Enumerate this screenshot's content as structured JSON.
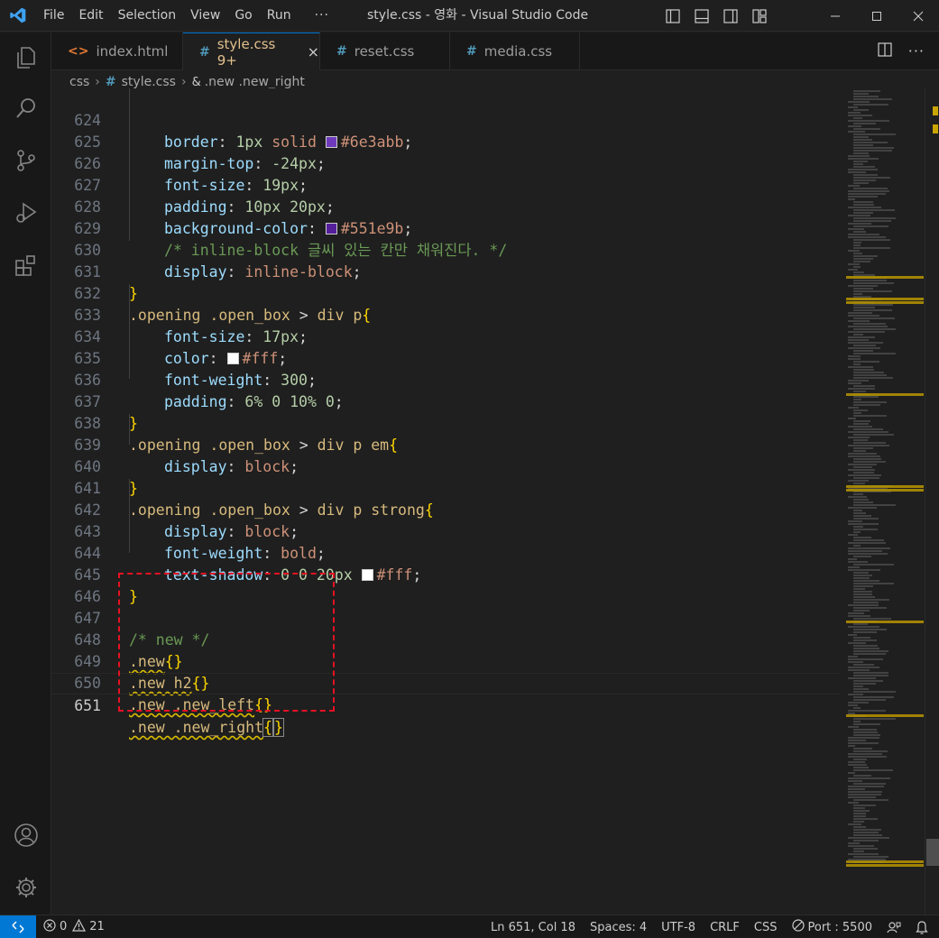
{
  "window": {
    "title": "style.css - 영화 - Visual Studio Code",
    "menu": [
      "File",
      "Edit",
      "Selection",
      "View",
      "Go",
      "Run"
    ],
    "menu_more": "···"
  },
  "tabs": [
    {
      "label": "index.html",
      "icon": "html-file-icon",
      "icon_glyph": "<>",
      "active": false
    },
    {
      "label": "style.css 9+",
      "icon": "css-file-icon",
      "icon_glyph": "#",
      "active": true,
      "close": "×"
    },
    {
      "label": "reset.css",
      "icon": "css-file-icon",
      "icon_glyph": "#",
      "active": false
    },
    {
      "label": "media.css",
      "icon": "css-file-icon",
      "icon_glyph": "#",
      "active": false
    }
  ],
  "breadcrumb": {
    "folder": "css",
    "file": "style.css",
    "symbol": ".new .new_right"
  },
  "code": {
    "lines": [
      {
        "n": "624",
        "text": "border: 1px solid #6e3abb;"
      },
      {
        "n": "625",
        "text": "margin-top: -24px;"
      },
      {
        "n": "626",
        "text": "font-size: 19px;"
      },
      {
        "n": "627",
        "text": "padding: 10px 20px;"
      },
      {
        "n": "628",
        "text": "background-color: #551e9b;"
      },
      {
        "n": "629",
        "text": "/* inline-block 글씨 있는 칸만 채워진다. */"
      },
      {
        "n": "630",
        "text": "display: inline-block;"
      },
      {
        "n": "631",
        "text": "}"
      },
      {
        "n": "632",
        "text": ".opening .open_box > div p{"
      },
      {
        "n": "633",
        "text": "font-size: 17px;"
      },
      {
        "n": "634",
        "text": "color: #fff;"
      },
      {
        "n": "635",
        "text": "font-weight: 300;"
      },
      {
        "n": "636",
        "text": "padding: 6% 0 10% 0;"
      },
      {
        "n": "637",
        "text": "}"
      },
      {
        "n": "638",
        "text": ".opening .open_box > div p em{"
      },
      {
        "n": "639",
        "text": "display: block;"
      },
      {
        "n": "640",
        "text": "}"
      },
      {
        "n": "641",
        "text": ".opening .open_box > div p strong{"
      },
      {
        "n": "642",
        "text": "display: block;"
      },
      {
        "n": "643",
        "text": "font-weight: bold;"
      },
      {
        "n": "644",
        "text": "text-shadow: 0 0 20px #fff;"
      },
      {
        "n": "645",
        "text": "}"
      },
      {
        "n": "646",
        "text": ""
      },
      {
        "n": "647",
        "text": "/* new */"
      },
      {
        "n": "648",
        "text": ".new{}"
      },
      {
        "n": "649",
        "text": ".new h2{}"
      },
      {
        "n": "650",
        "text": ".new .new_left{}"
      },
      {
        "n": "651",
        "text": ".new .new_right{}"
      }
    ],
    "current_line": "651",
    "swatch_colors": {
      "c6e3abb": "#6e3abb",
      "c551e9b": "#551e9b",
      "cfff": "#ffffff"
    }
  },
  "status": {
    "errors": "0",
    "warnings": "21",
    "position": "Ln 651, Col 18",
    "spaces": "Spaces: 4",
    "encoding": "UTF-8",
    "eol": "CRLF",
    "language": "CSS",
    "port": "Port : 5500"
  },
  "colors": {
    "accent": "#0078d4",
    "highlight_box": "#e81123"
  }
}
